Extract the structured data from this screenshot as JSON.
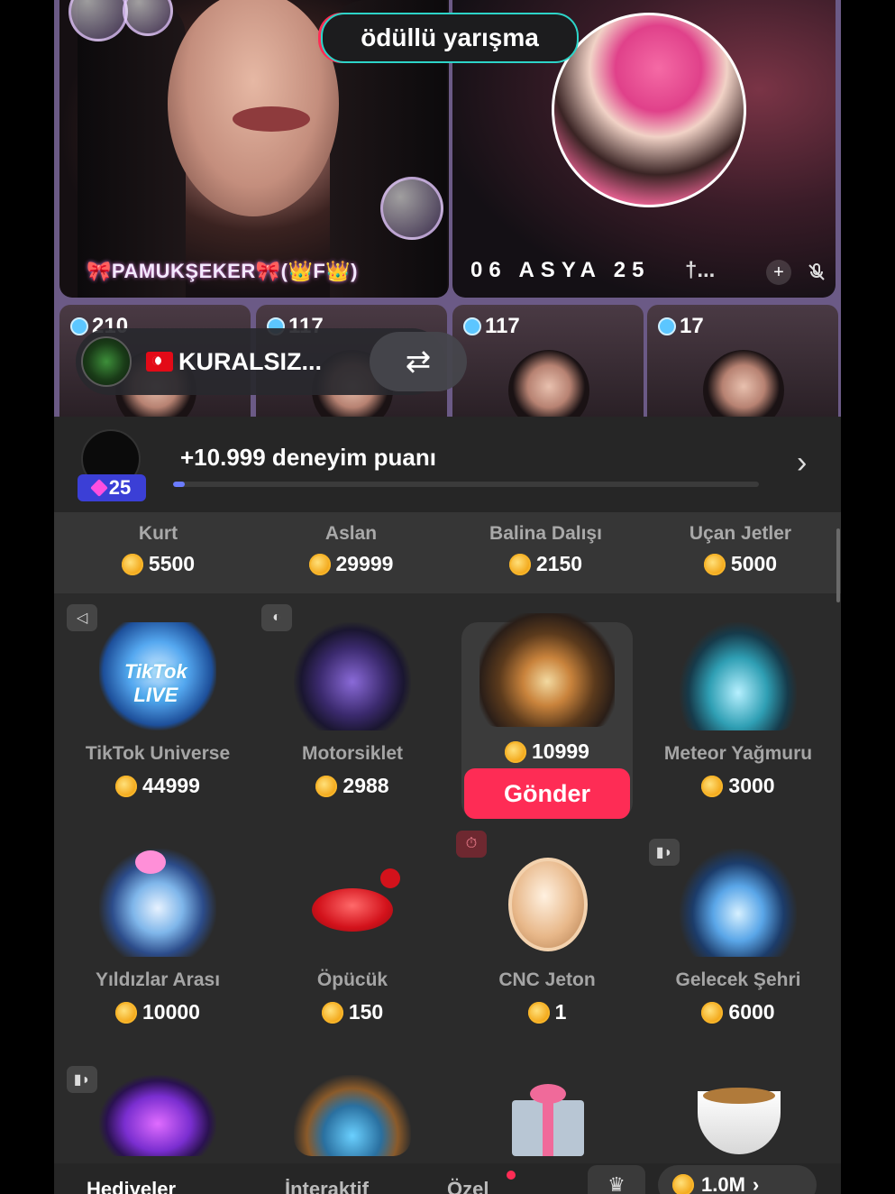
{
  "live": {
    "contest_label": "ödüllü yarışma",
    "host_left": {
      "name": "🎀PAMUKŞEKER🎀(👑F👑)"
    },
    "host_right": {
      "name": "06 ASYA 25",
      "suffix": "†..."
    },
    "mini_guests": [
      {
        "count": "210"
      },
      {
        "count": "117"
      },
      {
        "count": "117"
      },
      {
        "count": "17"
      }
    ],
    "team_pill": {
      "name": "KURALSIZ..."
    }
  },
  "panel": {
    "level": "25",
    "xp_text": "+10.999 deneyim puanı",
    "xp_progress": 0.02,
    "featured": [
      {
        "name": "Kurt",
        "price": "5500"
      },
      {
        "name": "Aslan",
        "price": "29999"
      },
      {
        "name": "Balina Dalışı",
        "price": "2150"
      },
      {
        "name": "Uçan Jetler",
        "price": "5000"
      }
    ],
    "gifts_row1": [
      {
        "name": "TikTok Universe",
        "price": "44999"
      },
      {
        "name": "Motorsiklet",
        "price": "2988"
      },
      {
        "name": "",
        "price": "10999"
      },
      {
        "name": "Meteor Yağmuru",
        "price": "3000"
      }
    ],
    "send_label": "Gönder",
    "gifts_row2": [
      {
        "name": "Yıldızlar Arası",
        "price": "10000"
      },
      {
        "name": "Öpücük",
        "price": "150"
      },
      {
        "name": "CNC Jeton",
        "price": "1"
      },
      {
        "name": "Gelecek Şehri",
        "price": "6000"
      }
    ],
    "tabs": [
      "Hediyeler",
      "İnteraktif",
      "Özel"
    ],
    "balance": "1.0M"
  },
  "colors": {
    "accent": "#fe2c55",
    "coin": "#f3a81a",
    "panel_bg": "#2b2b2b"
  }
}
